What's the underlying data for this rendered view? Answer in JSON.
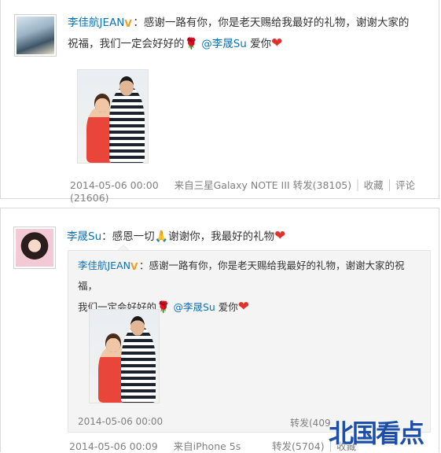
{
  "post1": {
    "author": "李佳航JEAN",
    "text_a": "：感谢一路有你，你是老天赐给我最好的礼物，谢谢大家的",
    "text_b": "祝福，我们一定会好好的",
    "mention": "@李晟Su",
    "text_c": " 爱你",
    "date": "2014-05-06 00:00",
    "source": "来自三星Galaxy NOTE III",
    "repost": "转发(38105)",
    "favorite": "收藏",
    "comment": "评论(21606)"
  },
  "post2": {
    "author": "李晟Su",
    "text_a": "：感恩一切",
    "text_b": "谢谢你，我最好的礼物",
    "date": "2014-05-06 00:09",
    "source": "来自iPhone 5s",
    "repost": "转发(5704)",
    "favorite": "收藏",
    "quote": {
      "author": "李佳航JEAN",
      "text_a": "：感谢一路有你，你是老天赐给我最好的礼物，谢谢大家的祝福，",
      "text_b": "我们一定会好好的",
      "mention": "@李晟Su",
      "text_c": " 爱你",
      "date": "2014-05-06 00:00",
      "repost": "转发(409"
    }
  },
  "icons": {
    "verified": "V",
    "heart": "❤",
    "rose": "🌹",
    "pray": "🙏"
  },
  "watermark": {
    "text": "北国看点",
    "colors": {
      "blue": "#1e4fa8",
      "red": "#d71e27"
    }
  },
  "colors": {
    "link": "#0a72b8",
    "meta": "#808080",
    "heart": "#e0322c"
  }
}
